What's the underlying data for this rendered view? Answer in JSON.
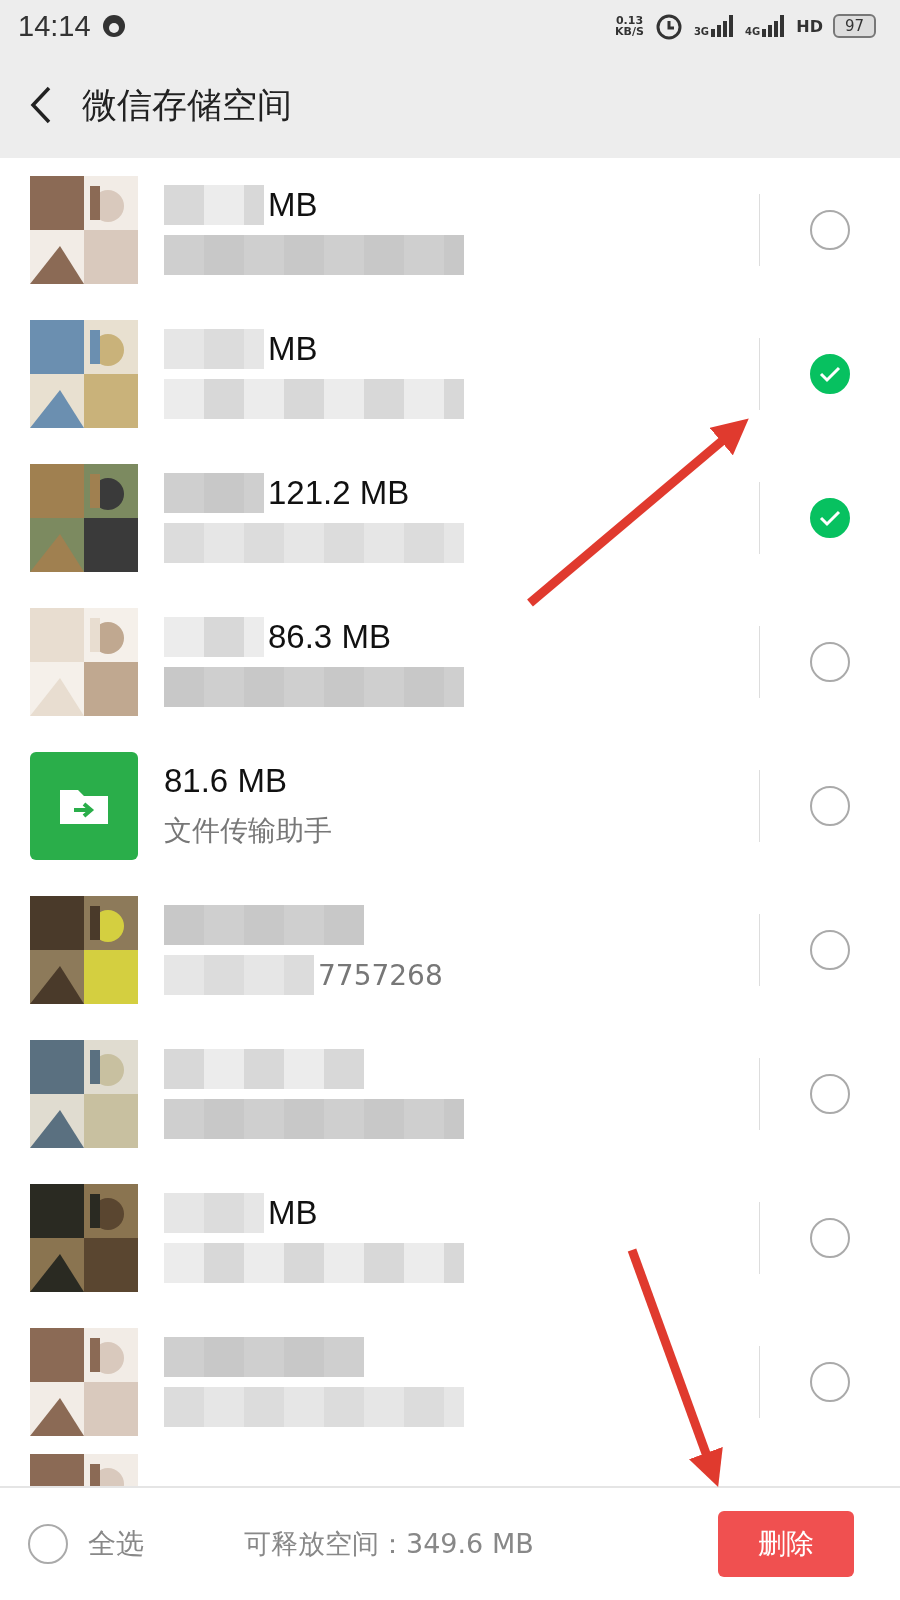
{
  "status_bar": {
    "time": "14:14",
    "speed": "0.13",
    "speed_unit": "KB/S",
    "net_3g": "3G",
    "net_4g": "4G",
    "hd": "HD",
    "battery": "97"
  },
  "header": {
    "title": "微信存储空间"
  },
  "rows": [
    {
      "kind": "picture",
      "redacted": true,
      "size": "MB",
      "selected": false
    },
    {
      "kind": "picture",
      "redacted": true,
      "size": "MB",
      "selected": true
    },
    {
      "kind": "picture",
      "redacted": true,
      "size": "121.2 MB",
      "selected": true
    },
    {
      "kind": "picture",
      "redacted": true,
      "size": "86.3 MB",
      "selected": false
    },
    {
      "kind": "folder",
      "redacted": false,
      "size": "81.6 MB",
      "subtitle": "文件传输助手",
      "selected": false
    },
    {
      "kind": "picture",
      "redacted": true,
      "subtitle": "7757268",
      "selected": false
    },
    {
      "kind": "picture",
      "redacted": true,
      "selected": false
    },
    {
      "kind": "picture",
      "redacted": true,
      "size": "MB",
      "selected": false
    },
    {
      "kind": "picture",
      "redacted": true,
      "selected": false
    }
  ],
  "footer": {
    "select_all": {
      "label": "全选",
      "selected": false
    },
    "free_space": "可释放空间：349.6 MB",
    "delete_button": "删除"
  }
}
